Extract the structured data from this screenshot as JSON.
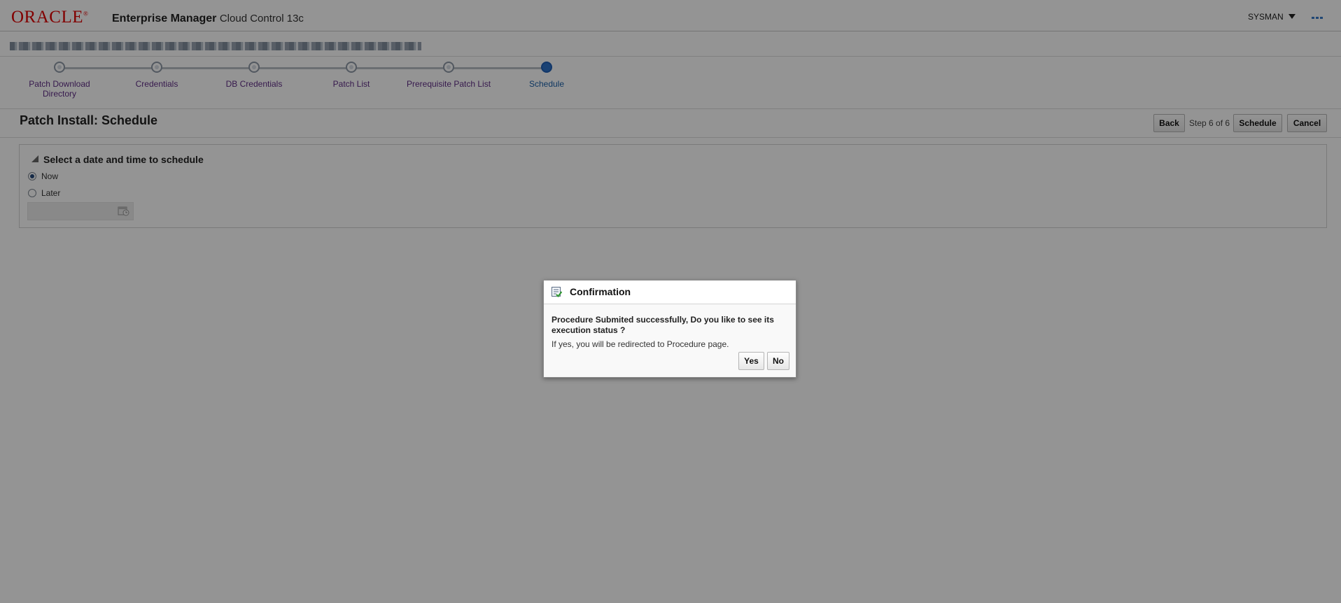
{
  "header": {
    "brand": "ORACLE",
    "product_bold": "Enterprise Manager",
    "product_rest": "Cloud Control 13c",
    "user": "SYSMAN"
  },
  "train": {
    "steps": [
      {
        "label": "Patch Download Directory",
        "state": "visited"
      },
      {
        "label": "Credentials",
        "state": "visited"
      },
      {
        "label": "DB Credentials",
        "state": "visited"
      },
      {
        "label": "Patch List",
        "state": "visited"
      },
      {
        "label": "Prerequisite Patch List",
        "state": "visited"
      },
      {
        "label": "Schedule",
        "state": "current"
      }
    ]
  },
  "page": {
    "title": "Patch Install: Schedule",
    "back_label": "Back",
    "step_text": "Step 6 of 6",
    "schedule_label": "Schedule",
    "cancel_label": "Cancel"
  },
  "schedule": {
    "section_title": "Select a date and time to schedule",
    "now_label": "Now",
    "later_label": "Later",
    "selected": "Now",
    "date_value": ""
  },
  "dialog": {
    "title": "Confirmation",
    "message": "Procedure Submited successfully, Do you like to see its execution status ?",
    "sub": "If yes, you will be redirected to Procedure page.",
    "yes_label": "Yes",
    "no_label": "No"
  },
  "colors": {
    "brand_red": "#e00000",
    "link_purple": "#5f2d86",
    "current_blue": "#1a5fa8"
  },
  "icons": {
    "user_menu": "chevron-down-icon",
    "more": "more-icon",
    "disclose": "disclosure-triangle-icon",
    "calendar": "calendar-icon",
    "dialog": "confirmation-icon"
  }
}
